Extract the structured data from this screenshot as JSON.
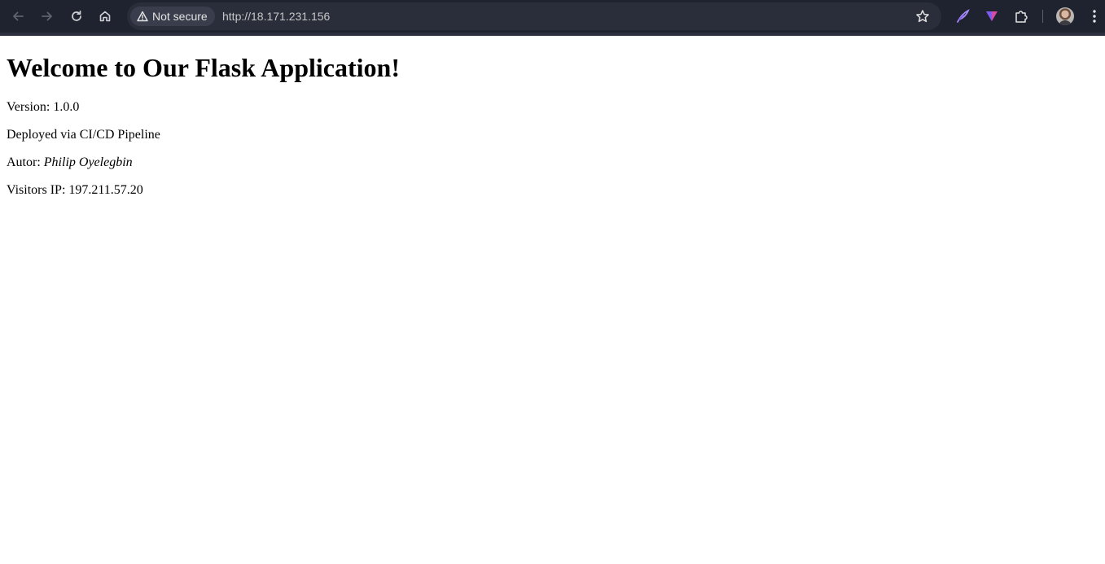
{
  "browser": {
    "security_chip": "Not secure",
    "url": "http://18.171.231.156",
    "icons": {
      "back": "back-arrow-icon",
      "forward": "forward-arrow-icon",
      "reload": "reload-icon",
      "home": "home-icon",
      "warning": "warning-icon",
      "bookmark": "star-icon",
      "extension_1": "feather-extension-icon",
      "extension_2": "flag-extension-icon",
      "extensions": "puzzle-icon",
      "profile": "avatar",
      "menu": "kebab-menu-icon"
    },
    "colors": {
      "toolbar": "#1f2330",
      "omnibox": "#2a2e3b",
      "chip": "#3a3e4c"
    }
  },
  "page": {
    "heading": "Welcome to Our Flask Application!",
    "version_label": "Version: 1.0.0",
    "deployment_label": "Deployed via CI/CD Pipeline",
    "author_prefix": "Autor: ",
    "author_name": "Philip Oyelegbin",
    "visitor_ip_label": "Visitors IP: 197.211.57.20"
  }
}
